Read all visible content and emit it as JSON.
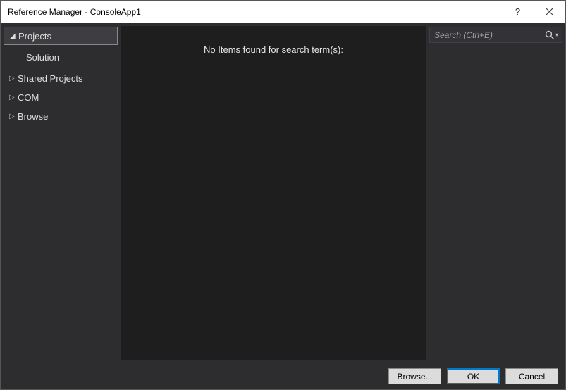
{
  "titlebar": {
    "title": "Reference Manager - ConsoleApp1",
    "help": "?",
    "close": "✕"
  },
  "sidebar": {
    "items": [
      {
        "label": "Projects",
        "expanded": true,
        "selected": true
      },
      {
        "label": "Shared Projects",
        "expanded": false
      },
      {
        "label": "COM",
        "expanded": false
      },
      {
        "label": "Browse",
        "expanded": false
      }
    ],
    "subitem": "Solution"
  },
  "center": {
    "empty_message": "No Items found for search term(s):"
  },
  "search": {
    "placeholder": "Search (Ctrl+E)"
  },
  "footer": {
    "browse": "Browse...",
    "ok": "OK",
    "cancel": "Cancel"
  }
}
